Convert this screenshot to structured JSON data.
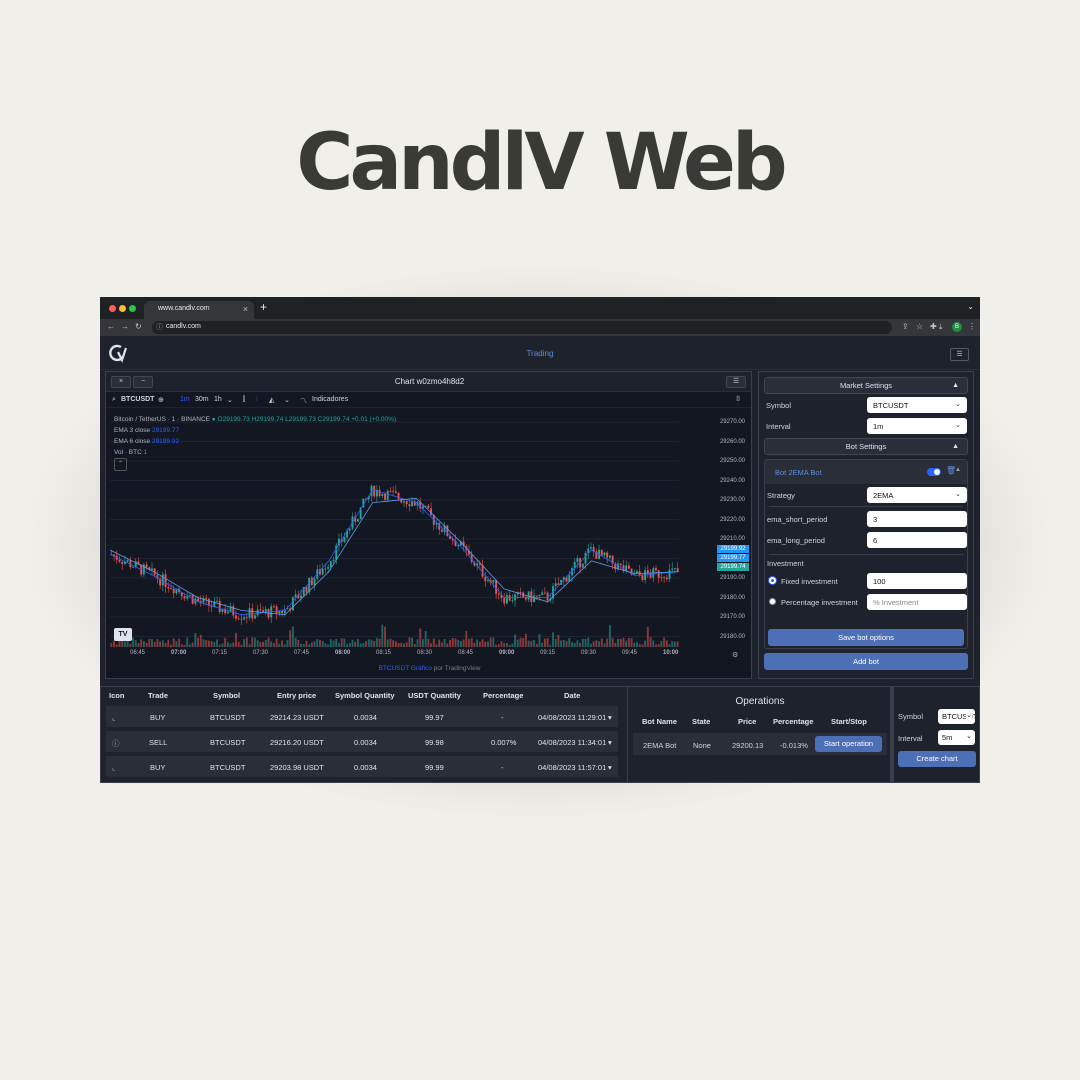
{
  "hero_title": "CandlV Web",
  "browser": {
    "tab_title": "www.candlv.com",
    "url": "candlv.com",
    "profile_initial": "B"
  },
  "app": {
    "nav_title": "Trading"
  },
  "chart": {
    "window_title": "Chart w0zmo4h8d2",
    "symbol": "BTCUSDT",
    "intervals": [
      "1m",
      "30m",
      "1h"
    ],
    "indicators_label": "Indicadores",
    "pair_label": "Bitcoin / TetherUS · 1 · BINANCE",
    "ohlc": "O29199.73 H29199.74 L29199.73 C29199.74 +0.01 (+0.00%)",
    "ema3_label": "EMA 3 close",
    "ema3_value": "29199.77",
    "ema6_label": "EMA 6 close",
    "ema6_value": "29199.92",
    "vol_label": "Vol · BTC",
    "vol_value": "1",
    "y_ticks": [
      "29270.00",
      "29260.00",
      "29250.00",
      "29240.00",
      "29230.00",
      "29220.00",
      "29210.00",
      "29200.00",
      "29190.00",
      "29180.00",
      "29170.00",
      "29180.00"
    ],
    "price_tags": [
      "29199.92",
      "29199.77",
      "29199.74"
    ],
    "x_ticks": [
      "06:45",
      "07:00",
      "07:15",
      "07:30",
      "07:45",
      "08:00",
      "08:15",
      "08:30",
      "08:45",
      "09:00",
      "09:15",
      "09:30",
      "09:45",
      "10:00"
    ],
    "credit_link": "BTCUSDT Gráfico",
    "credit_text": "por TradingView",
    "colors": {
      "up": "#26a69a",
      "down": "#ef5350",
      "ema": "#2962ff"
    }
  },
  "chart_data": {
    "type": "candlestick",
    "xlabel": "",
    "ylabel": "",
    "ylim": [
      29165,
      29275
    ],
    "x": [
      "06:45",
      "07:00",
      "07:15",
      "07:30",
      "07:45",
      "08:00",
      "08:15",
      "08:30",
      "08:45",
      "09:00",
      "09:15",
      "09:30",
      "09:45",
      "10:00"
    ],
    "series": [
      {
        "name": "EMA 3 close",
        "values": [
          29208,
          29198,
          29186,
          29180,
          29182,
          29205,
          29238,
          29232,
          29212,
          29188,
          29188,
          29210,
          29198,
          29200
        ]
      },
      {
        "name": "EMA 6 close",
        "values": [
          29210,
          29200,
          29188,
          29182,
          29180,
          29200,
          29232,
          29234,
          29214,
          29192,
          29186,
          29205,
          29199,
          29200
        ]
      }
    ]
  },
  "market_settings": {
    "title": "Market Settings",
    "symbol_label": "Symbol",
    "symbol_value": "BTCUSDT",
    "interval_label": "Interval",
    "interval_value": "1m"
  },
  "bot_settings": {
    "title": "Bot Settings",
    "bot_name": "Bot 2EMA Bot",
    "strategy_label": "Strategy",
    "strategy_value": "2EMA",
    "ema_short_label": "ema_short_period",
    "ema_short_value": "3",
    "ema_long_label": "ema_long_period",
    "ema_long_value": "6",
    "investment_label": "Investment",
    "fixed_label": "Fixed investment",
    "fixed_value": "100",
    "percentage_label": "Percentage investment",
    "percentage_placeholder": "% Investment",
    "save_button": "Save bot options",
    "add_button": "Add bot"
  },
  "trades": {
    "headers": [
      "Icon",
      "Trade",
      "Symbol",
      "Entry price",
      "Symbol Quantity",
      "USDT Quantity",
      "Percentage",
      "Date"
    ],
    "rows": [
      {
        "trade": "BUY",
        "symbol": "BTCUSDT",
        "entry": "29214.23 USDT",
        "qty": "0.0034",
        "usdt": "99.97",
        "pct": "-",
        "date": "04/08/2023 11:29:01"
      },
      {
        "trade": "SELL",
        "symbol": "BTCUSDT",
        "entry": "29216.20 USDT",
        "qty": "0.0034",
        "usdt": "99.98",
        "pct": "0.007%",
        "date": "04/08/2023 11:34:01"
      },
      {
        "trade": "BUY",
        "symbol": "BTCUSDT",
        "entry": "29203.98 USDT",
        "qty": "0.0034",
        "usdt": "99.99",
        "pct": "-",
        "date": "04/08/2023 11:57:01"
      }
    ]
  },
  "operations": {
    "title": "Operations",
    "headers": [
      "Bot Name",
      "State",
      "Price",
      "Percentage",
      "Start/Stop"
    ],
    "row": {
      "bot": "2EMA Bot",
      "state": "None",
      "price": "29200.13",
      "pct": "-0.013%",
      "button": "Start operation"
    }
  },
  "quick_chart": {
    "symbol_label": "Symbol",
    "symbol_value": "BTCUSDT",
    "interval_label": "Interval",
    "interval_value": "5m",
    "button": "Create chart"
  }
}
